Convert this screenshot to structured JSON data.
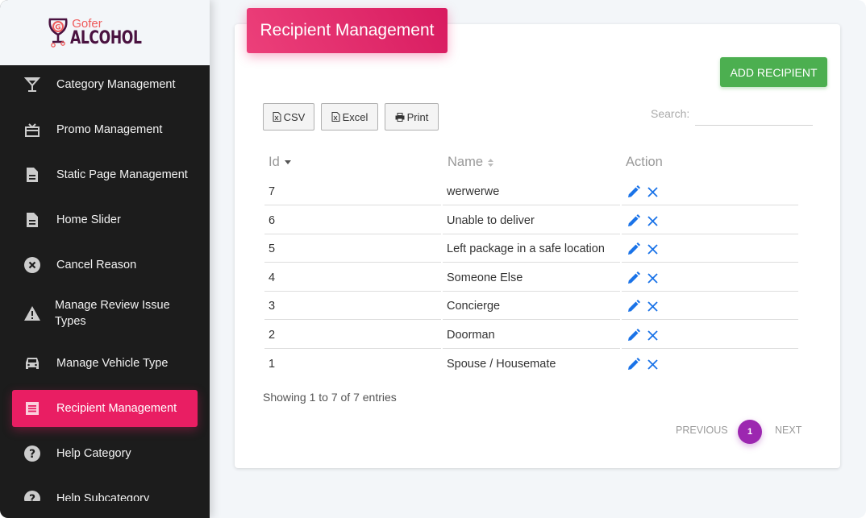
{
  "brand": {
    "top": "Gofer",
    "bottom": "ALCOHOL",
    "colors": {
      "top": "#ef5a5a",
      "bottom": "#4a1240"
    }
  },
  "sidebar": {
    "items": [
      {
        "label": "Category Management",
        "icon": "cocktail-glass-icon",
        "active": false
      },
      {
        "label": "Promo Management",
        "icon": "gift-icon",
        "active": false
      },
      {
        "label": "Static Page Management",
        "icon": "document-icon",
        "active": false
      },
      {
        "label": "Home Slider",
        "icon": "document-icon",
        "active": false
      },
      {
        "label": "Cancel Reason",
        "icon": "cancel-circle-icon",
        "active": false
      },
      {
        "label": "Manage Review Issue Types",
        "icon": "warning-triangle-icon",
        "active": false
      },
      {
        "label": "Manage Vehicle Type",
        "icon": "car-icon",
        "active": false
      },
      {
        "label": "Recipient Management",
        "icon": "receipt-icon",
        "active": true
      },
      {
        "label": "Help Category",
        "icon": "help-circle-icon",
        "active": false
      },
      {
        "label": "Help Subcategory",
        "icon": "help-circle-icon",
        "active": false
      }
    ]
  },
  "page": {
    "title": "Recipient Management",
    "add_button": "ADD RECIPIENT",
    "export_buttons": {
      "csv": "CSV",
      "excel": "Excel",
      "print": "Print"
    },
    "search": {
      "label": "Search:",
      "value": "",
      "placeholder": ""
    },
    "table": {
      "columns": [
        {
          "label": "Id",
          "sort": "desc"
        },
        {
          "label": "Name",
          "sort": "none"
        },
        {
          "label": "Action",
          "sort": null
        }
      ],
      "rows": [
        {
          "id": "7",
          "name": "werwerwe"
        },
        {
          "id": "6",
          "name": "Unable to deliver"
        },
        {
          "id": "5",
          "name": "Left package in a safe location"
        },
        {
          "id": "4",
          "name": "Someone Else"
        },
        {
          "id": "3",
          "name": "Concierge"
        },
        {
          "id": "2",
          "name": "Doorman"
        },
        {
          "id": "1",
          "name": "Spouse / Housemate"
        }
      ]
    },
    "info": "Showing 1 to 7 of 7 entries",
    "pagination": {
      "previous": "PREVIOUS",
      "current": "1",
      "next": "NEXT"
    },
    "colors": {
      "header": "#e91e63",
      "add": "#4caf50",
      "page": "#9c27b0",
      "action": "#1a73e8"
    }
  }
}
